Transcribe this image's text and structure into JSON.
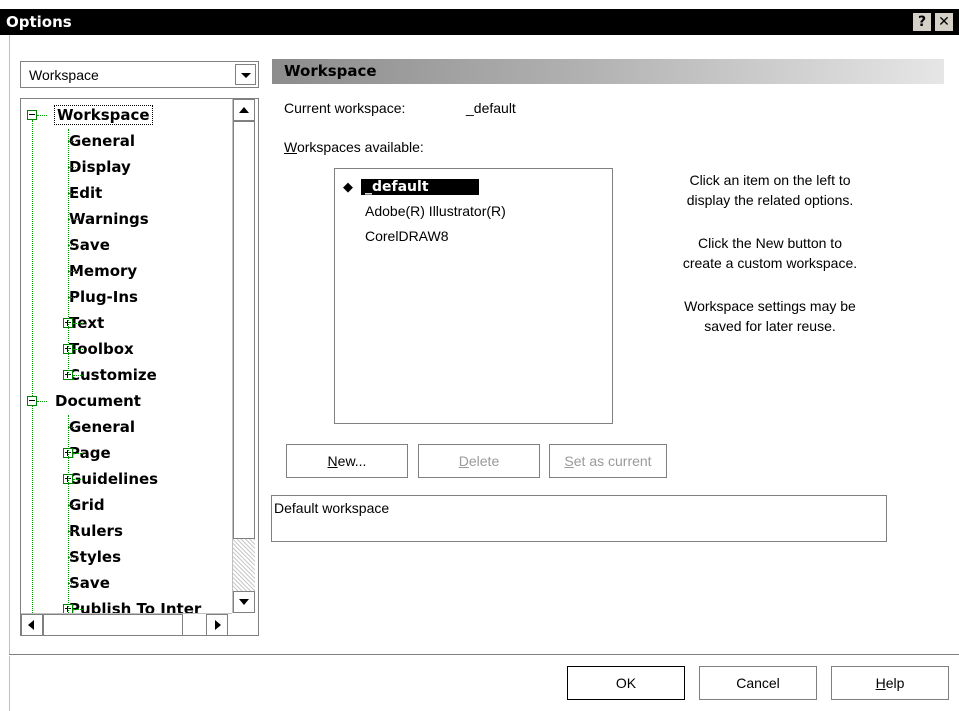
{
  "window": {
    "title": "Options",
    "help_glyph": "?",
    "close_glyph": "✕"
  },
  "category_combo": {
    "value": "Workspace"
  },
  "tree": {
    "items": [
      {
        "label": "Workspace",
        "expander": "minus"
      },
      {
        "label": "General"
      },
      {
        "label": "Display"
      },
      {
        "label": "Edit"
      },
      {
        "label": "Warnings"
      },
      {
        "label": "Save"
      },
      {
        "label": "Memory"
      },
      {
        "label": "Plug-Ins"
      },
      {
        "label": "Text",
        "expander": "plus"
      },
      {
        "label": "Toolbox",
        "expander": "plus"
      },
      {
        "label": "Customize",
        "expander": "plus"
      },
      {
        "label": "Document",
        "expander": "minus"
      },
      {
        "label": "General"
      },
      {
        "label": "Page",
        "expander": "plus"
      },
      {
        "label": "Guidelines",
        "expander": "plus"
      },
      {
        "label": "Grid"
      },
      {
        "label": "Rulers"
      },
      {
        "label": "Styles"
      },
      {
        "label": "Save"
      },
      {
        "label": "Publish To Inter",
        "expander": "plus"
      }
    ]
  },
  "panel": {
    "title": "Workspace",
    "current_label": "Current workspace:",
    "current_value": "_default",
    "available_label_prefix": "W",
    "available_label_rest": "orkspaces available:",
    "workspaces": [
      "_default",
      "Adobe(R) Illustrator(R)",
      "CorelDRAW8"
    ],
    "active_bullet": "◆",
    "info_lines": [
      "Click an item on the left to",
      "display the related options.",
      "Click the New button to",
      "create a custom workspace.",
      "Workspace settings may be",
      "saved for later reuse."
    ],
    "buttons": {
      "new_prefix": "N",
      "new_rest": "ew...",
      "delete_prefix": "D",
      "delete_rest": "elete",
      "setcurrent_prefix": "S",
      "setcurrent_rest": "et as current"
    },
    "description": "Default workspace"
  },
  "footer": {
    "ok_label": "OK",
    "cancel_label": "Cancel",
    "help_prefix": "H",
    "help_rest": "elp"
  },
  "colors": {
    "tree_lines": "#00a000",
    "titlebar": "#000000",
    "selection": "#000000"
  }
}
